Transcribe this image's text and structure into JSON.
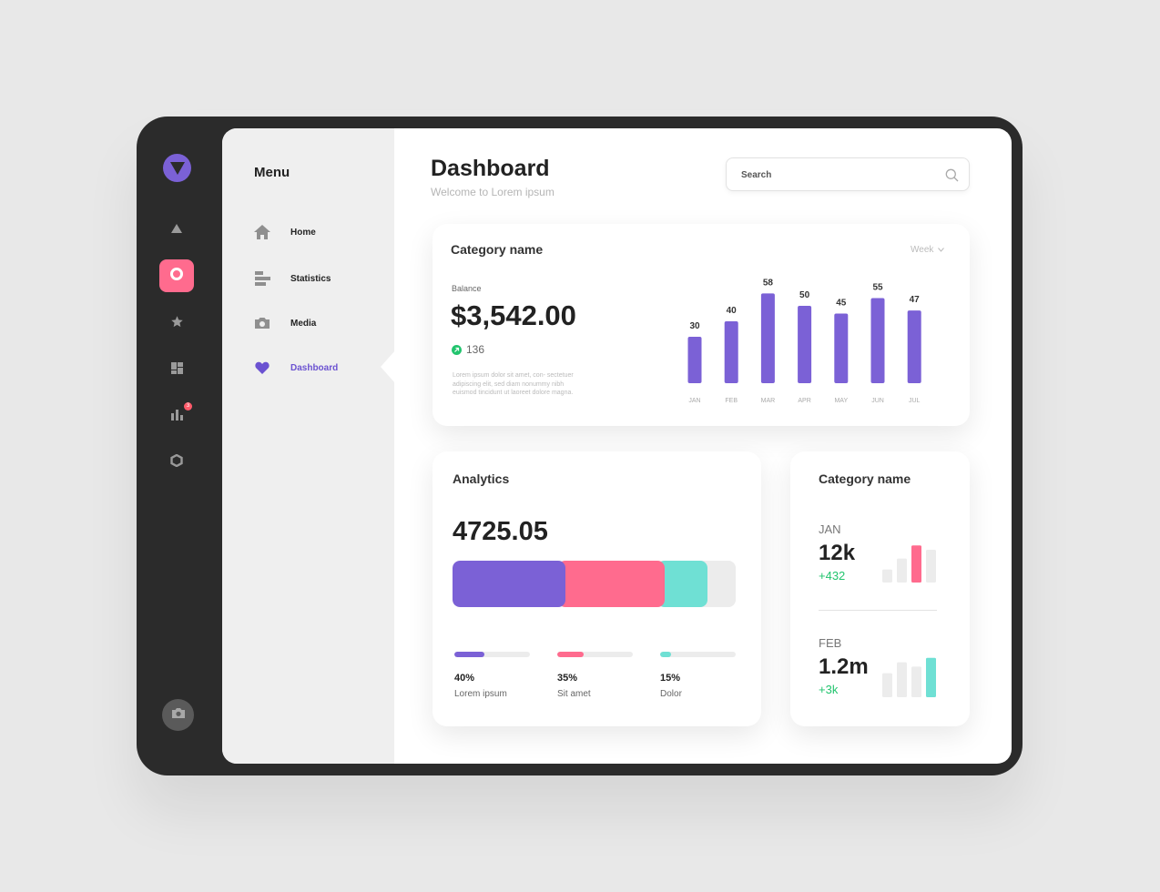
{
  "menu": {
    "title": "Menu",
    "items": [
      {
        "label": "Home",
        "icon": "home-icon"
      },
      {
        "label": "Statistics",
        "icon": "statistics-icon"
      },
      {
        "label": "Media",
        "icon": "camera-icon"
      },
      {
        "label": "Dashboard",
        "icon": "heart-icon"
      }
    ]
  },
  "rail": {
    "badge_count": "3",
    "icons": [
      "triangle-icon",
      "record-icon",
      "star-icon",
      "layout-icon",
      "bar-chart-icon",
      "hexagon-icon"
    ]
  },
  "header": {
    "title": "Dashboard",
    "subtitle": "Welcome to Lorem ipsum",
    "search_placeholder": "Search"
  },
  "balance_card": {
    "title": "Category name",
    "period": "Week",
    "balance_label": "Balance",
    "amount": "$3,542.00",
    "change": "136",
    "description": "Lorem ipsum dolor sit amet, con- sectetuer adipiscing elit, sed diam nonummy nibh euismod tincidunt ut laoreet dolore magna."
  },
  "chart_data": {
    "type": "bar",
    "categories": [
      "JAN",
      "FEB",
      "MAR",
      "APR",
      "MAY",
      "JUN",
      "JUL"
    ],
    "values": [
      30,
      40,
      58,
      50,
      45,
      55,
      47
    ],
    "ylim": [
      0,
      60
    ],
    "grid": false,
    "color": "#7b61d6"
  },
  "analytics": {
    "title": "Analytics",
    "value": "4725.05",
    "segments": [
      {
        "label": "Lorem ipsum",
        "percent": "40%",
        "fraction": 0.4,
        "color": "#7b61d6"
      },
      {
        "label": "Sit amet",
        "percent": "35%",
        "fraction": 0.35,
        "color": "#ff6b8e"
      },
      {
        "label": "Dolor",
        "percent": "15%",
        "fraction": 0.15,
        "color": "#6fe0d4"
      }
    ]
  },
  "category_card": {
    "title": "Category name",
    "entries": [
      {
        "month": "JAN",
        "value": "12k",
        "delta": "+432",
        "bars": [
          0.3,
          0.55,
          0.85,
          0.75
        ],
        "highlight_index": 2,
        "highlight_color": "#ff6b8e"
      },
      {
        "month": "FEB",
        "value": "1.2m",
        "delta": "+3k",
        "bars": [
          0.55,
          0.8,
          0.7,
          0.9
        ],
        "highlight_index": 3,
        "highlight_color": "#6fe0d4"
      }
    ]
  },
  "colors": {
    "accent": "#7b61d6",
    "pink": "#ff6b8e",
    "teal": "#6fe0d4",
    "positive": "#22c46e",
    "dark_frame": "#2b2b2b"
  }
}
